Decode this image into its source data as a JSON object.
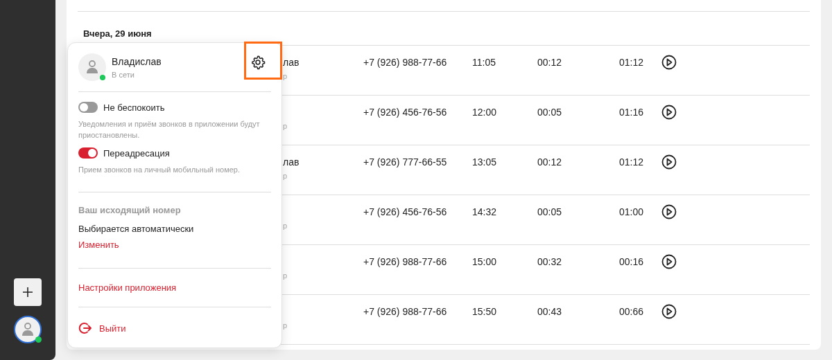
{
  "sidebar": {
    "user_online": true
  },
  "calls": {
    "group_title": "Вчера, 29 июня",
    "rows": [
      {
        "name": "лав",
        "sub": "р",
        "phone": "+7 (926) 988-77-66",
        "time": "11:05",
        "wait": "00:12",
        "duration": "01:12"
      },
      {
        "name": "",
        "sub": "р",
        "phone": "+7 (926) 456-76-56",
        "time": "12:00",
        "wait": "00:05",
        "duration": "01:16"
      },
      {
        "name": "лав",
        "sub": "р",
        "phone": "+7 (926) 777-66-55",
        "time": "13:05",
        "wait": "00:12",
        "duration": "01:12"
      },
      {
        "name": "",
        "sub": "р",
        "phone": "+7 (926) 456-76-56",
        "time": "14:32",
        "wait": "00:05",
        "duration": "01:00"
      },
      {
        "name": "",
        "sub": "р",
        "phone": "+7 (926) 988-77-66",
        "time": "15:00",
        "wait": "00:32",
        "duration": "00:16"
      },
      {
        "name": "",
        "sub": "р",
        "phone": "+7 (926) 988-77-66",
        "time": "15:50",
        "wait": "00:43",
        "duration": "00:66"
      }
    ]
  },
  "profile_menu": {
    "user": {
      "name": "Владислав",
      "status": "В сети",
      "online": true
    },
    "settings_highlighted": true,
    "toggles": [
      {
        "label": "Не беспокоить",
        "on": false,
        "description": "Уведомления и приём звонков в приложении будут приостановлены."
      },
      {
        "label": "Переадресация",
        "on": true,
        "description": "Прием звонков на личный мобильный номер."
      }
    ],
    "outgoing": {
      "title": "Ваш исходящий номер",
      "value": "Выбирается автоматически",
      "action": "Изменить"
    },
    "app_settings": "Настройки приложения",
    "logout": "Выйти"
  }
}
